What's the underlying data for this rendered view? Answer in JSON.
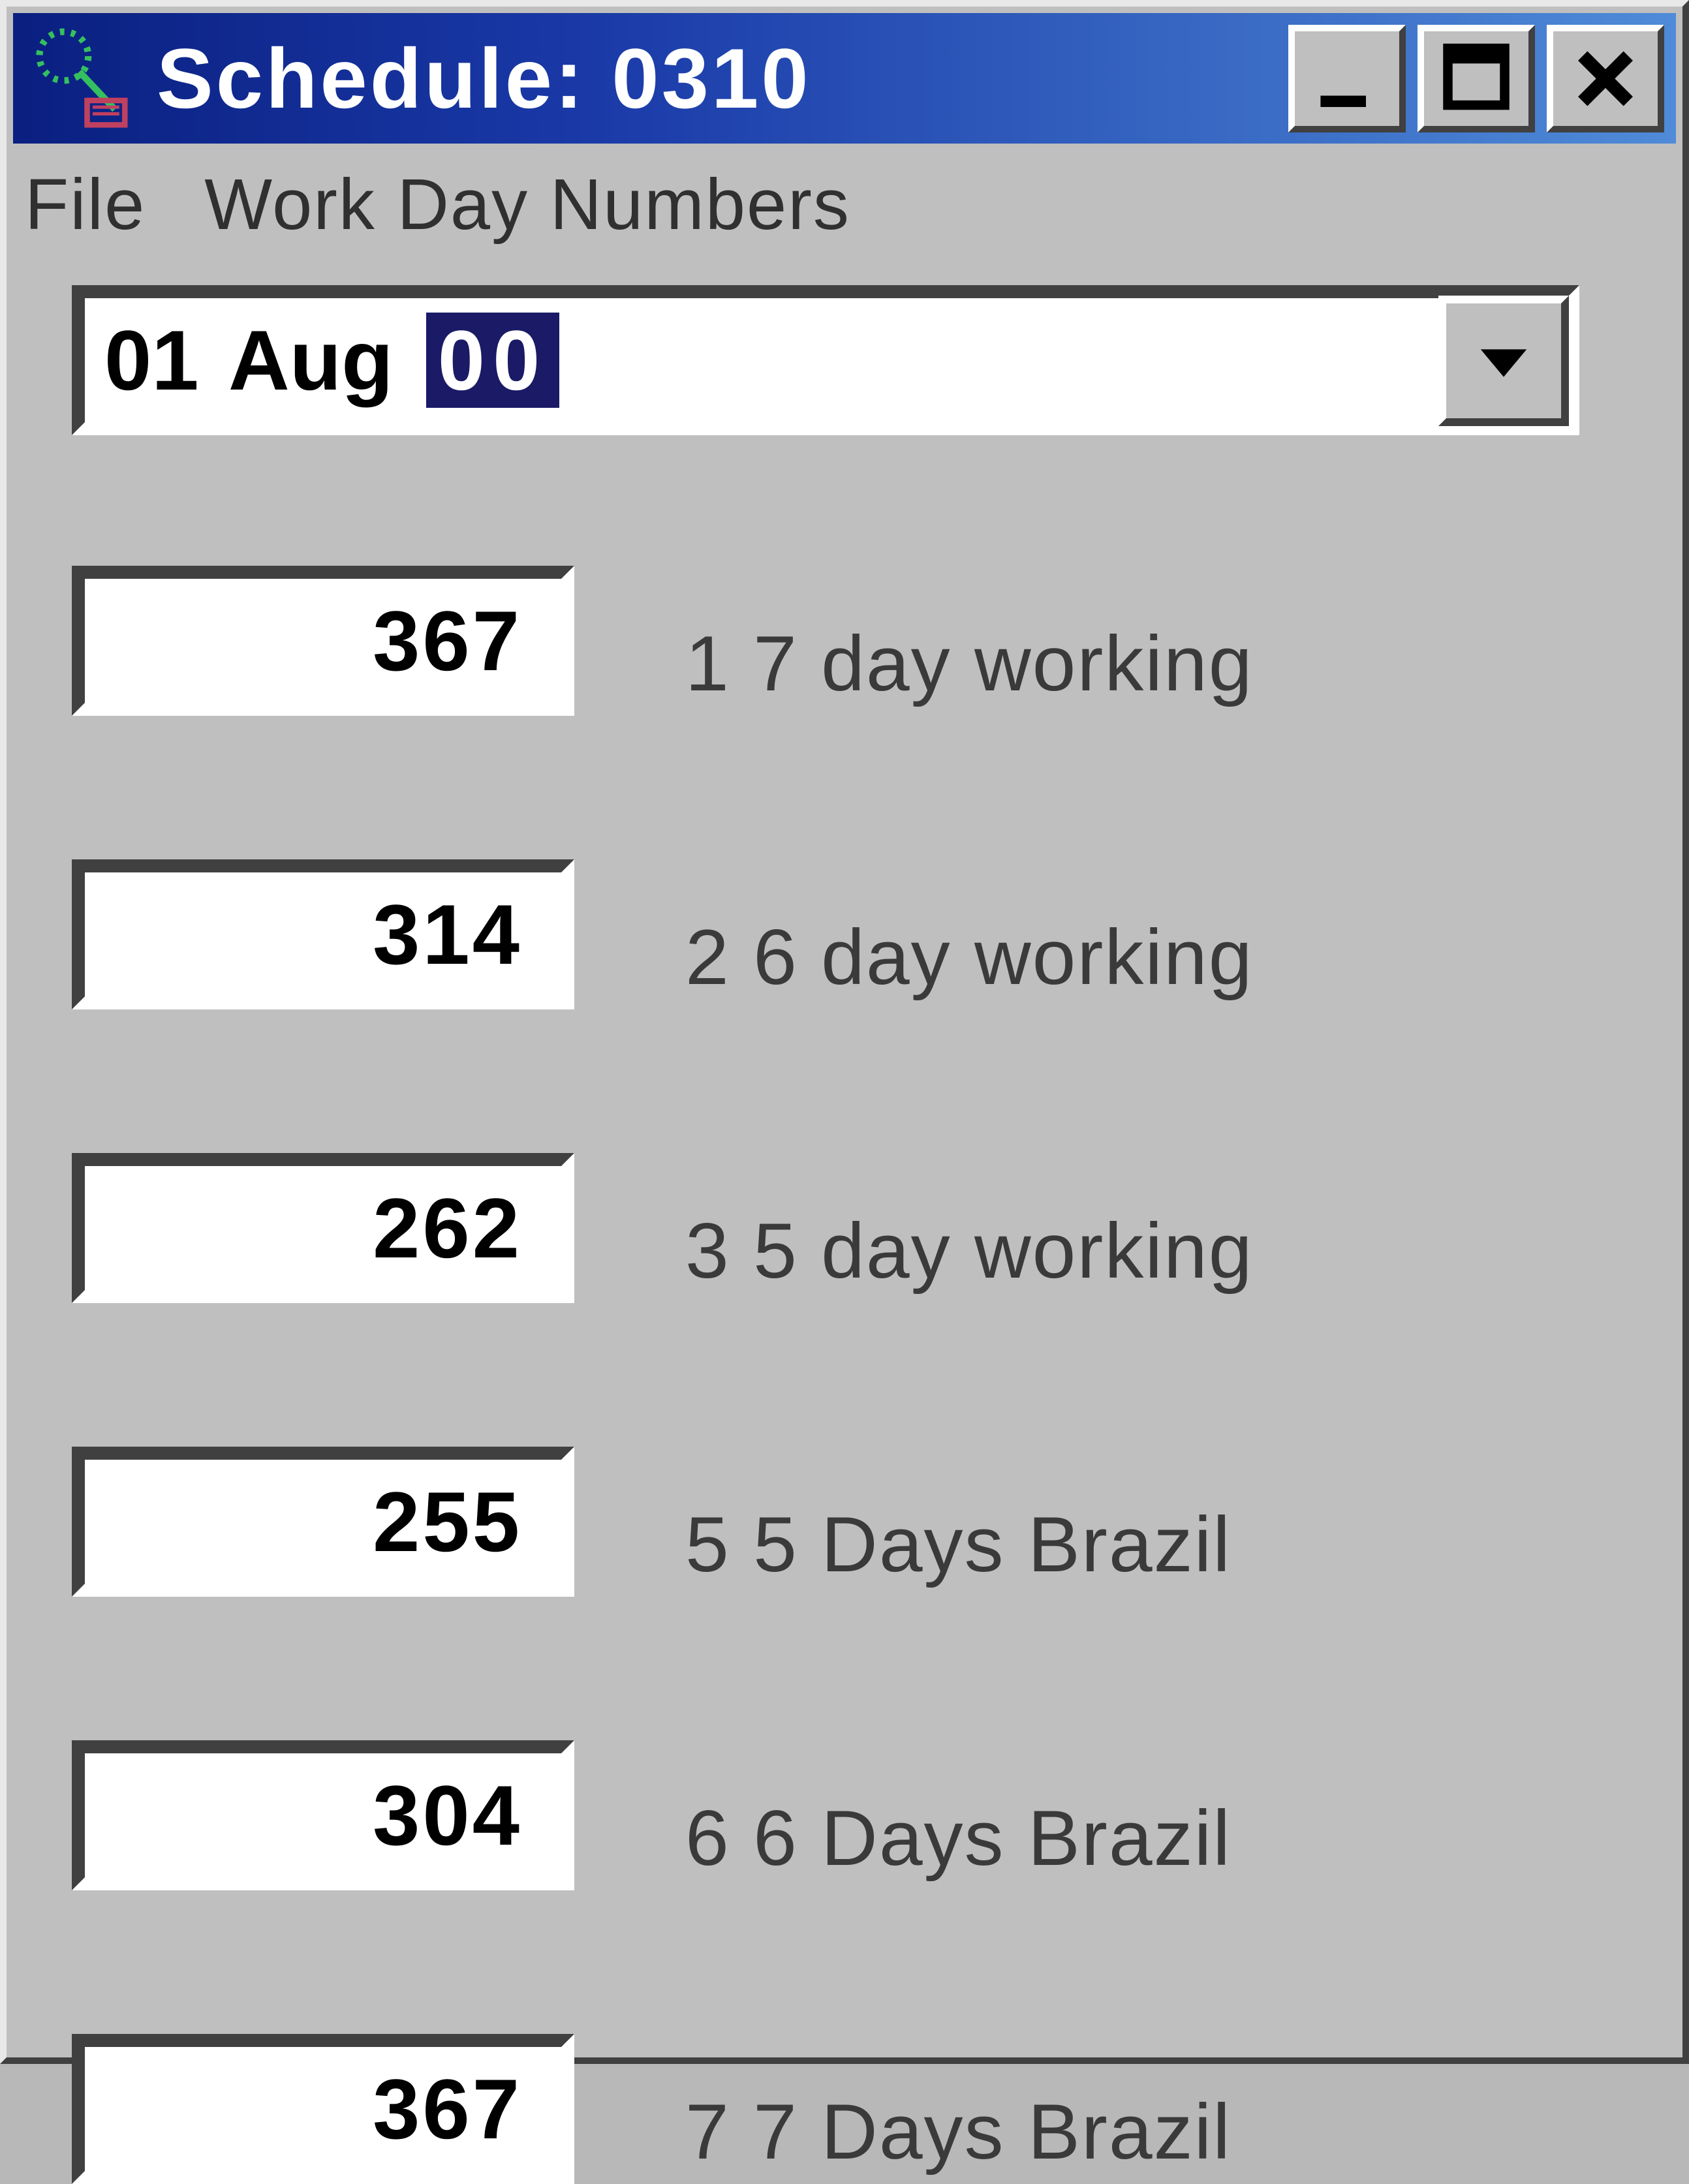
{
  "window": {
    "title": "Schedule: 0310"
  },
  "menu": {
    "file": "File",
    "wdn": "Work Day Numbers"
  },
  "combo": {
    "prefix": "01 Aug",
    "selected": "00"
  },
  "rows": [
    {
      "value": "367",
      "label": "1 7 day working"
    },
    {
      "value": "314",
      "label": "2 6 day working"
    },
    {
      "value": "262",
      "label": "3 5 day working"
    },
    {
      "value": "255",
      "label": "5 5 Days Brazil"
    },
    {
      "value": "304",
      "label": "6 6 Days Brazil"
    },
    {
      "value": "367",
      "label": "7 7 Days Brazil"
    }
  ]
}
